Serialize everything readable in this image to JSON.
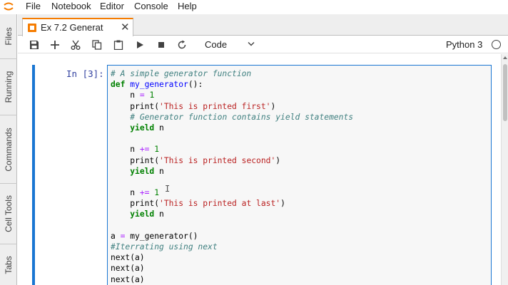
{
  "menubar": {
    "items": [
      "File",
      "Notebook",
      "Editor",
      "Console",
      "Help"
    ]
  },
  "sidebar": {
    "tabs": [
      "Files",
      "Running",
      "Commands",
      "Cell Tools",
      "Tabs"
    ]
  },
  "document_tab": {
    "title": "Ex 7.2 Generat",
    "close": "✕"
  },
  "toolbar": {
    "buttons": [
      "save-icon",
      "add-icon",
      "cut-icon",
      "copy-icon",
      "paste-icon",
      "run-icon",
      "stop-icon",
      "restart-icon"
    ],
    "cell_type": "Code",
    "kernel_name": "Python 3"
  },
  "cell": {
    "prompt": "In [3]:",
    "code_lines": [
      "# A simple generator function",
      "def my_generator():",
      "    n = 1",
      "    print('This is printed first')",
      "    # Generator function contains yield statements",
      "    yield n",
      "",
      "    n += 1",
      "    print('This is printed second')",
      "    yield n",
      "",
      "    n += 1",
      "    print('This is printed at last')",
      "    yield n",
      "",
      "a = my_generator()",
      "#Iterrating using next",
      "next(a)",
      "next(a)",
      "next(a)"
    ]
  },
  "colors": {
    "accent_blue": "#1976d2",
    "brand_orange": "#f57c00",
    "comment": "#408080",
    "keyword": "#008000",
    "string": "#ba2121"
  }
}
